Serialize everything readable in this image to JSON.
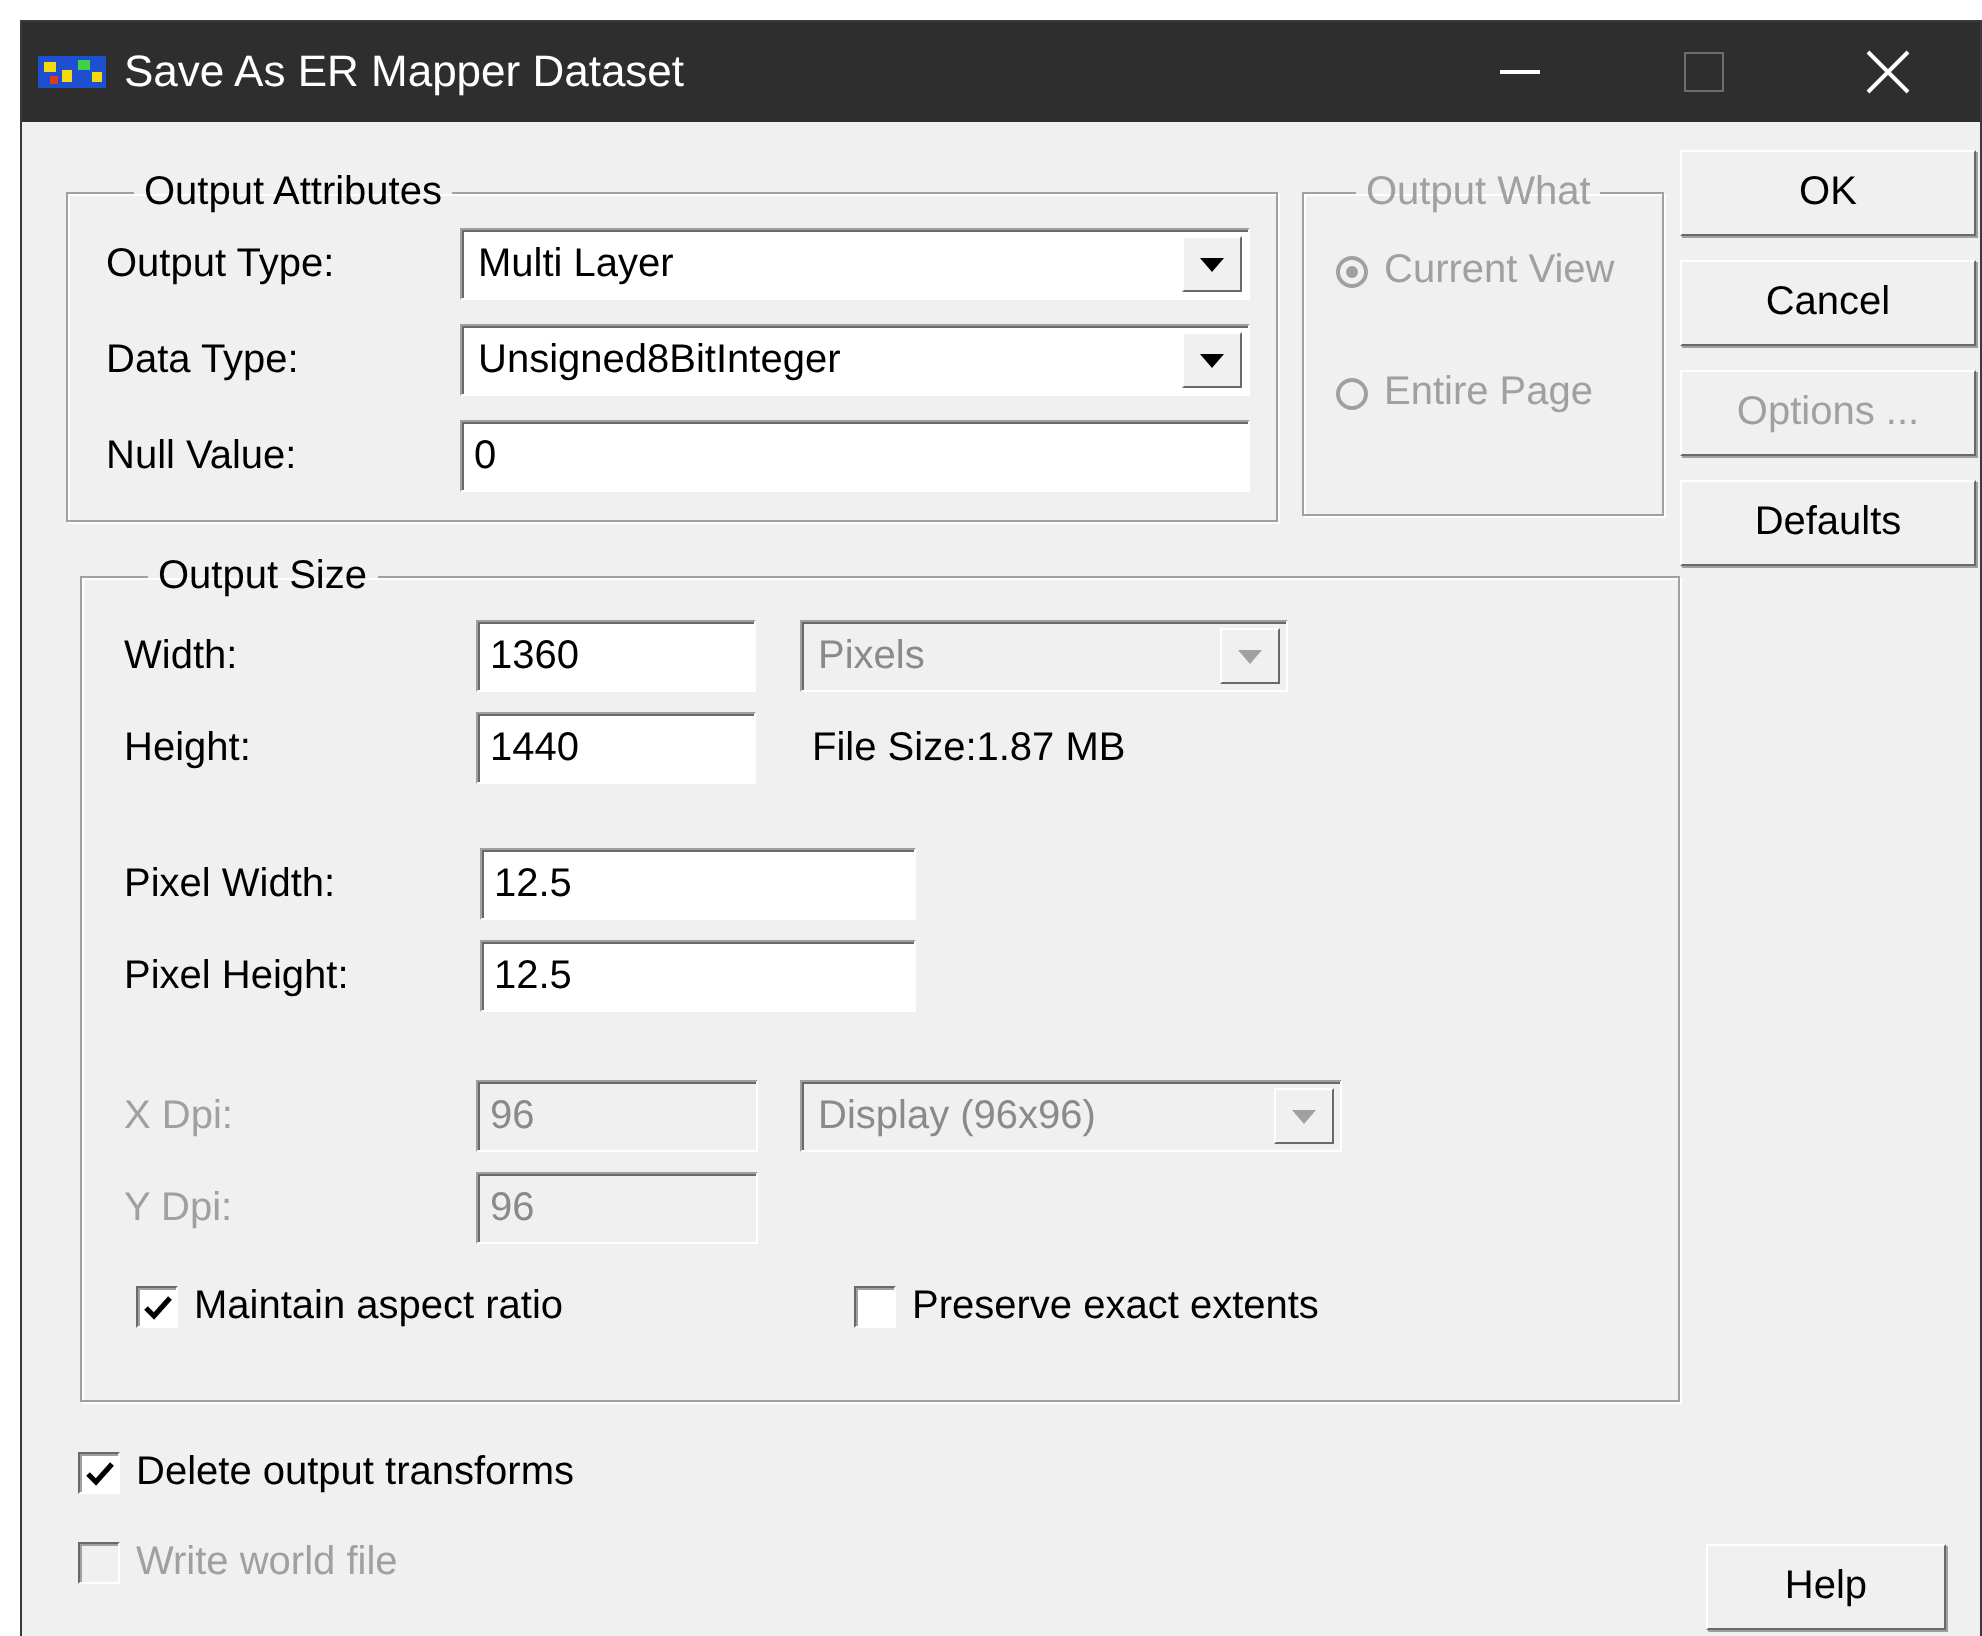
{
  "window": {
    "title": "Save As ER Mapper Dataset"
  },
  "title_buttons": [
    {
      "kind": "minimize",
      "disabled": false
    },
    {
      "kind": "maximize",
      "disabled": true
    },
    {
      "kind": "close",
      "disabled": false
    }
  ],
  "output_attributes": {
    "title": "Output Attributes",
    "fields": [
      {
        "label": "Output Type:",
        "kind": "dropdown",
        "value": "Multi Layer"
      },
      {
        "label": "Data Type:",
        "kind": "dropdown",
        "value": "Unsigned8BitInteger"
      },
      {
        "label": "Null Value:",
        "kind": "text",
        "value": "0"
      }
    ]
  },
  "output_what": {
    "title": "Output What",
    "disabled": true,
    "options": [
      {
        "label": "Current View",
        "selected": true
      },
      {
        "label": "Entire Page",
        "selected": false
      }
    ]
  },
  "output_size": {
    "title": "Output Size",
    "width": {
      "label": "Width:",
      "value": "1360"
    },
    "units": {
      "value": "Pixels",
      "disabled": true
    },
    "height": {
      "label": "Height:",
      "value": "1440"
    },
    "file_size": "File Size:1.87 MB",
    "pixel_width": {
      "label": "Pixel Width:",
      "value": "12.5"
    },
    "pixel_height": {
      "label": "Pixel Height:",
      "value": "12.5"
    },
    "x_dpi": {
      "label": "X Dpi:",
      "value": "96",
      "disabled": true
    },
    "dpi_preset": {
      "value": "Display (96x96)",
      "disabled": true
    },
    "y_dpi": {
      "label": "Y Dpi:",
      "value": "96",
      "disabled": true
    },
    "maintain_aspect": {
      "label": "Maintain aspect ratio",
      "checked": true,
      "disabled": false
    },
    "preserve_extents": {
      "label": "Preserve exact extents",
      "checked": false,
      "disabled": false
    }
  },
  "options": [
    {
      "label": "Delete output transforms",
      "checked": true,
      "disabled": false
    },
    {
      "label": "Write world file",
      "checked": false,
      "disabled": true
    }
  ],
  "buttons": [
    {
      "label": "OK",
      "disabled": false
    },
    {
      "label": "Cancel",
      "disabled": false
    },
    {
      "label": "Options ...",
      "disabled": true
    },
    {
      "label": "Defaults",
      "disabled": false
    }
  ],
  "help_button": {
    "label": "Help",
    "disabled": false
  }
}
